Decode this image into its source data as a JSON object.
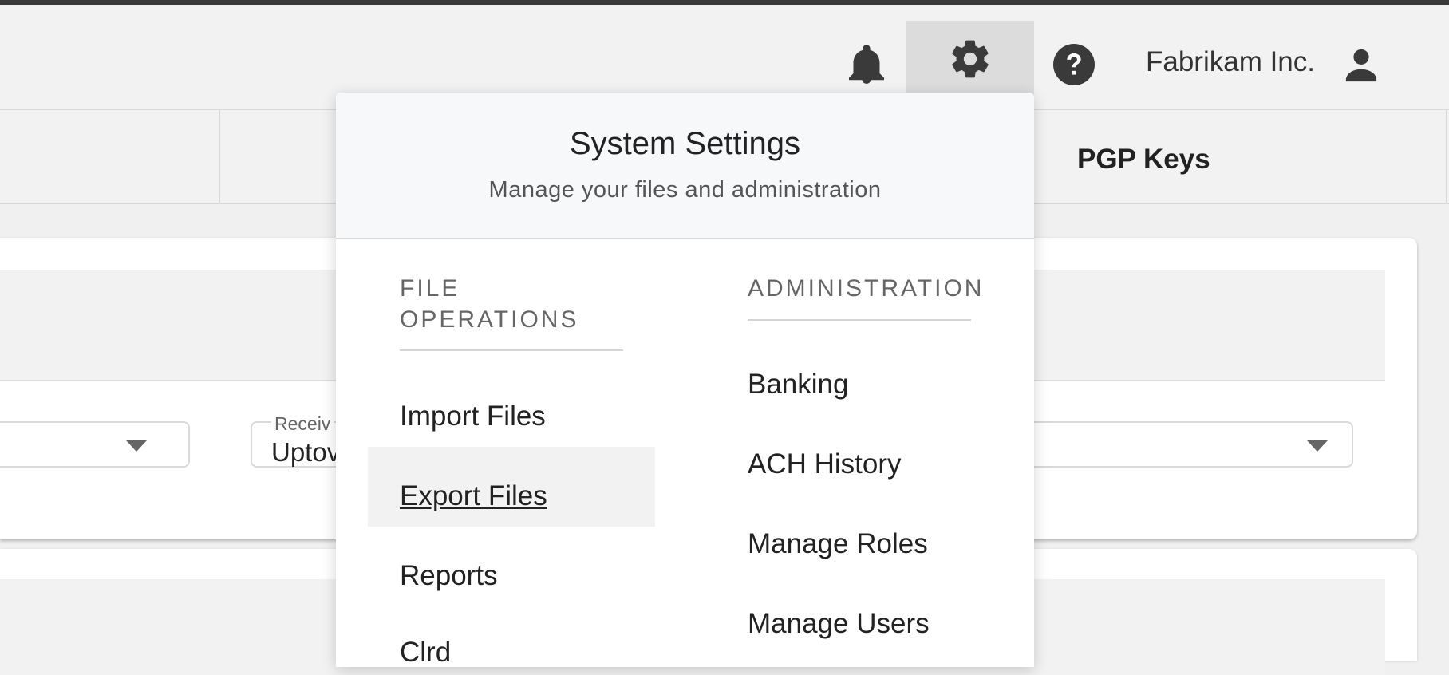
{
  "header": {
    "org_name": "Fabrikam Inc.",
    "icons": [
      "bell-icon",
      "gear-icon",
      "help-icon",
      "user-icon"
    ]
  },
  "tabs": {
    "pgp_label": "PGP Keys"
  },
  "form": {
    "receiver_label": "Receiv",
    "receiver_value": "Uptov"
  },
  "settings_menu": {
    "title": "System Settings",
    "subtitle": "Manage your files and administration",
    "file_operations": {
      "heading_line1": "FILE",
      "heading_line2": "OPERATIONS",
      "items": [
        "Import Files",
        "Export Files",
        "Reports",
        "Clrd"
      ]
    },
    "administration": {
      "heading": "ADMINISTRATION",
      "items": [
        "Banking",
        "ACH History",
        "Manage Roles",
        "Manage Users"
      ]
    }
  },
  "colors": {
    "gear_active_bg": "#dcdcdc",
    "panel_header_bg": "#f7f8f9",
    "active_item_bg": "#f2f2f2"
  }
}
